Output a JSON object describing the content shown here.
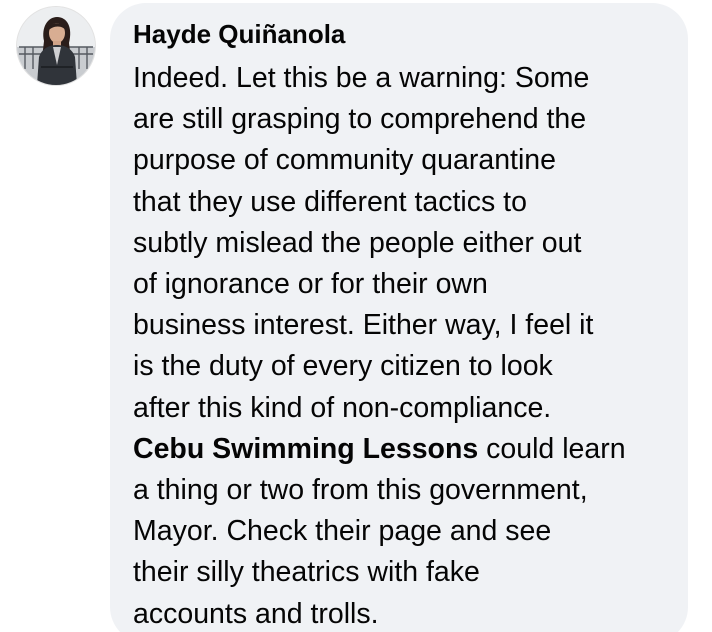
{
  "comment": {
    "author": "Hayde Quiñanola",
    "lines_before_mention": [
      "Indeed. Let this be a warning: Some",
      "are still grasping to comprehend the",
      "purpose of community quarantine",
      "that they use different tactics to",
      "subtly mislead the people either out",
      "of ignorance or for their own",
      "business interest. Either way, I feel it",
      "is the duty of every citizen to look",
      "after this kind of non-compliance."
    ],
    "mention": "Cebu Swimming Lessons",
    "mention_suffix": " could learn",
    "lines_after_mention": [
      "a thing or two from this government,",
      "Mayor. Check their page and see",
      "their silly theatrics with fake",
      "accounts and trolls."
    ]
  },
  "colors": {
    "bubble_background": "#f0f2f5",
    "text": "#050505",
    "page_background": "#ffffff"
  },
  "icons": {
    "avatar": "user-profile-photo"
  }
}
